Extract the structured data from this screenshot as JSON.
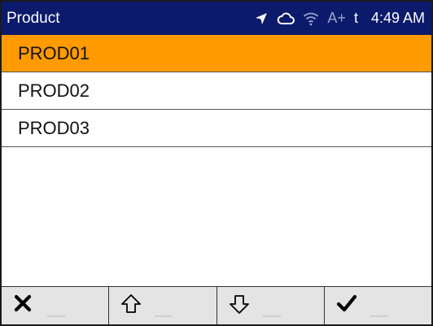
{
  "statusbar": {
    "title": "Product",
    "icons": [
      "navigation-arrow-icon",
      "cloud-icon",
      "wifi-icon"
    ],
    "auth_label": "A+",
    "mode_label": "t",
    "time": "4:49 AM",
    "background_color": "#0b1a6b"
  },
  "list": {
    "items": [
      {
        "label": "PROD01",
        "selected": true
      },
      {
        "label": "PROD02",
        "selected": false
      },
      {
        "label": "PROD03",
        "selected": false
      }
    ],
    "selected_color": "#ff9a00"
  },
  "softkeys": [
    {
      "icon": "cancel-x-icon"
    },
    {
      "icon": "arrow-up-icon"
    },
    {
      "icon": "arrow-down-icon"
    },
    {
      "icon": "checkmark-icon"
    }
  ]
}
